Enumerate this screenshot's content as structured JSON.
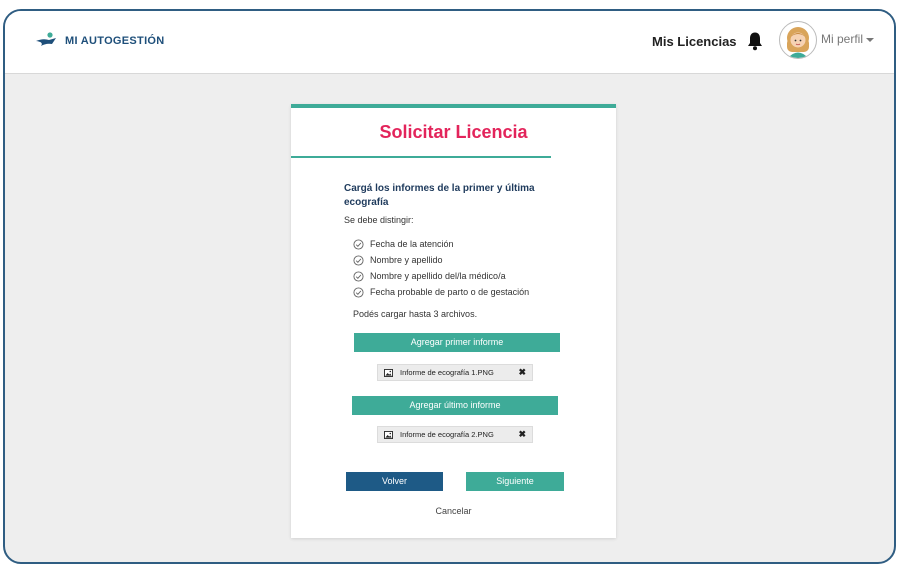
{
  "header": {
    "brand": "MI AUTOGESTIÓN",
    "nav_link": "Mis Licencias",
    "profile_label": "Mi perfil"
  },
  "card": {
    "title": "Solicitar Licencia",
    "heading": "Cargá los informes de la primer y última ecografía",
    "subheading": "Se debe distingir:",
    "checklist": [
      "Fecha de la atención",
      "Nombre y apellido",
      "Nombre y apellido del/la médico/a",
      "Fecha probable de parto o de gestación"
    ],
    "limit_note": "Podés cargar hasta 3 archivos.",
    "upload_first_label": "Agregar primer informe",
    "file_first": "Informe de ecografía 1.PNG",
    "upload_last_label": "Agregar último informe",
    "file_last": "Informe de ecografía 2.PNG",
    "back_label": "Volver",
    "next_label": "Siguiente",
    "cancel_label": "Cancelar"
  },
  "icons": {
    "brand": "autogestion-logo-icon",
    "bell": "bell-icon",
    "avatar": "avatar-icon",
    "caret": "caret-down-icon",
    "check": "check-circle-icon",
    "image": "image-file-icon",
    "remove": "close-icon"
  },
  "colors": {
    "title": "#e3245b",
    "teal": "#3eab98",
    "navy": "#1e5a86",
    "frame": "#2f5d82",
    "background": "#eeeeee"
  }
}
